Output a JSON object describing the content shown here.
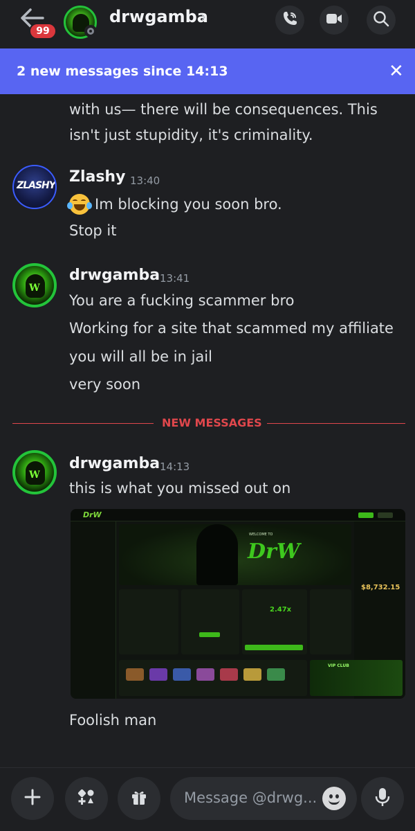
{
  "header": {
    "unread_badge": "99",
    "channel_name": "drwgamba",
    "chevron": "›",
    "icons": [
      "back-arrow-icon",
      "phone-call-icon",
      "video-camera-icon",
      "search-icon"
    ]
  },
  "banner": {
    "text": "2 new messages since 14:13",
    "close": "✕"
  },
  "messages": [
    {
      "continuation_lines": [
        "with us— there will be consequences. This",
        "isn't just stupidity, it's criminality."
      ]
    },
    {
      "author": "Zlashy",
      "avatar_text": "ZLASHY",
      "time": "13:40",
      "lines": [
        "Im blocking you soon bro.",
        "Stop it"
      ],
      "emoji": "joy-emoji"
    },
    {
      "author": "drwgamba",
      "time": "13:41",
      "lines": [
        "You are a fucking scammer bro",
        "Working for a site that scammed my affiliate",
        "you will all be in jail",
        "very soon"
      ]
    },
    {
      "author": "drwgamba",
      "time": "14:13",
      "lines": [
        "this is what you missed out on"
      ],
      "attachment": {
        "logo": "DrW",
        "welcome": "WELCOME TO",
        "brand": "DrW",
        "balance": "$8,732.15",
        "multiplier": "2.47x",
        "vip_title": "VIP CLUB"
      },
      "after_lines": [
        "Foolish man"
      ]
    }
  ],
  "divider": {
    "label": "NEW MESSAGES"
  },
  "composer": {
    "placeholder": "Message @drwg...",
    "icons": [
      "plus-icon",
      "apps-icon",
      "gift-icon",
      "emoji-icon",
      "microphone-icon"
    ]
  },
  "colors": {
    "background": "#1e1f22",
    "banner": "#5865f2",
    "divider": "#e0474c",
    "badge": "#da373c"
  }
}
